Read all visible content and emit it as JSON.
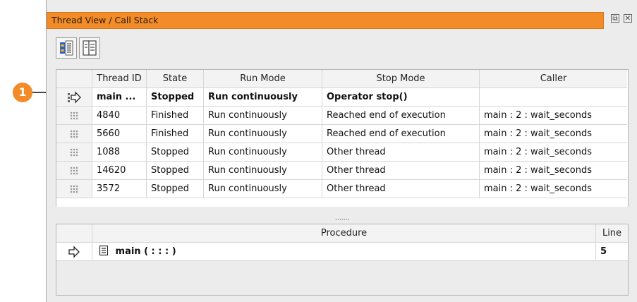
{
  "callout": {
    "number": "1"
  },
  "panel": {
    "title": "Thread View / Call Stack",
    "restore_label": "⧉",
    "close_label": "✕"
  },
  "toolbar": [
    {
      "icon": "thread-view-icon",
      "active": true
    },
    {
      "icon": "call-stack-icon",
      "active": false
    }
  ],
  "threads": {
    "columns": [
      "",
      "Thread ID",
      "State",
      "Run Mode",
      "Stop Mode",
      "Caller"
    ],
    "rows": [
      {
        "marker": "current-thread-arrow-icon",
        "thread_id": "main ...",
        "state": "Stopped",
        "run_mode": "Run continuously",
        "stop_mode": "Operator stop()",
        "caller": ""
      },
      {
        "marker": "thread-grip-icon",
        "thread_id": "4840",
        "state": "Finished",
        "run_mode": "Run continuously",
        "stop_mode": "Reached end of execution",
        "caller": "main : 2 : wait_seconds"
      },
      {
        "marker": "thread-grip-icon",
        "thread_id": "5660",
        "state": "Finished",
        "run_mode": "Run continuously",
        "stop_mode": "Reached end of execution",
        "caller": "main : 2 : wait_seconds"
      },
      {
        "marker": "thread-grip-icon",
        "thread_id": "1088",
        "state": "Stopped",
        "run_mode": "Run continuously",
        "stop_mode": "Other thread",
        "caller": "main : 2 : wait_seconds"
      },
      {
        "marker": "thread-grip-icon",
        "thread_id": "14620",
        "state": "Stopped",
        "run_mode": "Run continuously",
        "stop_mode": "Other thread",
        "caller": "main : 2 : wait_seconds"
      },
      {
        "marker": "thread-grip-icon",
        "thread_id": "3572",
        "state": "Stopped",
        "run_mode": "Run continuously",
        "stop_mode": "Other thread",
        "caller": "main : 2 : wait_seconds"
      }
    ]
  },
  "callstack": {
    "columns": [
      "",
      "Procedure",
      "Line"
    ],
    "rows": [
      {
        "marker": "current-frame-arrow-icon",
        "procedure": "main ( : : : )",
        "line": "5"
      }
    ]
  }
}
